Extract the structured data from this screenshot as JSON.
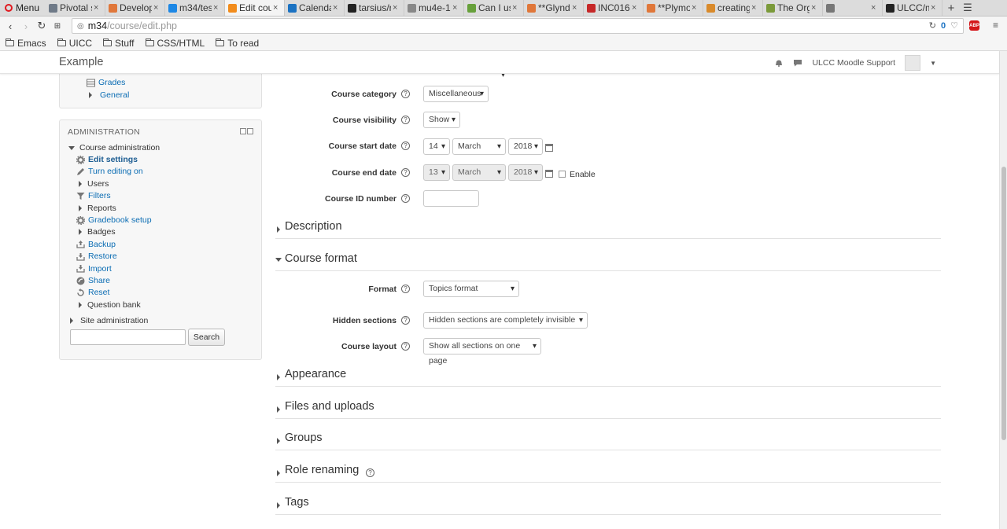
{
  "browser": {
    "menu_label": "Menu",
    "tabs": [
      {
        "title": "Pivotal s",
        "color": "#6f7a88"
      },
      {
        "title": "Develop",
        "color": "#e0773a"
      },
      {
        "title": "m34/tes",
        "color": "#1e88e5"
      },
      {
        "title": "Edit cou",
        "color": "#f28c1c"
      },
      {
        "title": "Calenda",
        "color": "#1b72c2"
      },
      {
        "title": "tarsius/r",
        "color": "#222222"
      },
      {
        "title": "mu4e-1",
        "color": "#888888"
      },
      {
        "title": "Can I us",
        "color": "#67a03b"
      },
      {
        "title": "**Glynd",
        "color": "#e0773a"
      },
      {
        "title": "INC016:",
        "color": "#c62828"
      },
      {
        "title": "**Plymo",
        "color": "#e0773a"
      },
      {
        "title": "creating",
        "color": "#d98a2b"
      },
      {
        "title": "The Org",
        "color": "#7b9a3a"
      },
      {
        "title": "",
        "color": "#777777"
      },
      {
        "title": "ULCC/m",
        "color": "#222222"
      }
    ],
    "url_host": "m34",
    "url_path": "/course/edit.php",
    "counter": "0",
    "abp_label": "ABP",
    "bookmarks": [
      "Emacs",
      "UICC",
      "Stuff",
      "CSS/HTML",
      "To read"
    ]
  },
  "navbar": {
    "brand": "Example",
    "user": "ULCC Moodle Support"
  },
  "nav_block": {
    "items": [
      "Grades",
      "General"
    ]
  },
  "admin_block": {
    "title": "ADMINISTRATION",
    "course_admin": "Course administration",
    "items": [
      {
        "label": "Edit settings",
        "icon": "gear-icon"
      },
      {
        "label": "Turn editing on",
        "icon": "pencil-icon"
      },
      {
        "label": "Users",
        "icon": "triangle-right"
      },
      {
        "label": "Filters",
        "icon": "filter-icon"
      },
      {
        "label": "Reports",
        "icon": "triangle-right"
      },
      {
        "label": "Gradebook setup",
        "icon": "gear-icon"
      },
      {
        "label": "Badges",
        "icon": "triangle-right"
      },
      {
        "label": "Backup",
        "icon": "backup-icon"
      },
      {
        "label": "Restore",
        "icon": "restore-icon"
      },
      {
        "label": "Import",
        "icon": "import-icon"
      },
      {
        "label": "Share",
        "icon": "share-icon"
      },
      {
        "label": "Reset",
        "icon": "reset-icon"
      },
      {
        "label": "Question bank",
        "icon": "triangle-right"
      }
    ],
    "site_admin": "Site administration",
    "search_placeholder": "",
    "search_button": "Search"
  },
  "form": {
    "category_label": "Course category",
    "category_value": "Miscellaneous",
    "visibility_label": "Course visibility",
    "visibility_value": "Show",
    "start_label": "Course start date",
    "start_day": "14",
    "start_month": "March",
    "start_year": "2018",
    "end_label": "Course end date",
    "end_day": "13",
    "end_month": "March",
    "end_year": "2018",
    "end_enable_label": "Enable",
    "idnumber_label": "Course ID number",
    "idnumber_value": "",
    "format_label": "Format",
    "format_value": "Topics format",
    "hidden_label": "Hidden sections",
    "hidden_value": "Hidden sections are completely invisible",
    "layout_label": "Course layout",
    "layout_value": "Show all sections on one page"
  },
  "sections": {
    "description": "Description",
    "course_format": "Course format",
    "appearance": "Appearance",
    "files": "Files and uploads",
    "groups": "Groups",
    "roles": "Role renaming",
    "tags": "Tags"
  }
}
